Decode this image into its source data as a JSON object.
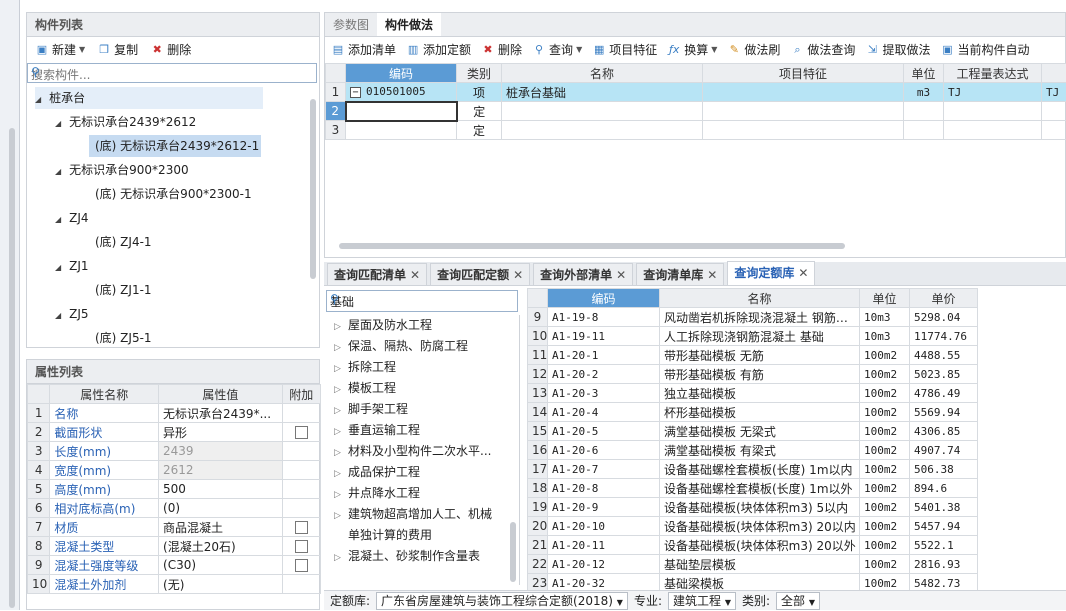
{
  "left_panel": {
    "title": "构件列表",
    "toolbar": {
      "new_label": "新建",
      "copy_label": "复制",
      "delete_label": "删除"
    },
    "search_placeholder": "搜索构件...",
    "tree": [
      {
        "label": "桩承台",
        "level": 0,
        "expanded": true,
        "state": "hl"
      },
      {
        "label": "无标识承台2439*2612",
        "level": 1,
        "expanded": true
      },
      {
        "label": "(底) 无标识承台2439*2612-1",
        "level": 2,
        "state": "sel"
      },
      {
        "label": "无标识承台900*2300",
        "level": 1,
        "expanded": true
      },
      {
        "label": "(底) 无标识承台900*2300-1",
        "level": 2
      },
      {
        "label": "ZJ4",
        "level": 1,
        "expanded": true
      },
      {
        "label": "(底) ZJ4-1",
        "level": 2
      },
      {
        "label": "ZJ1",
        "level": 1,
        "expanded": true
      },
      {
        "label": "(底) ZJ1-1",
        "level": 2
      },
      {
        "label": "ZJ5",
        "level": 1,
        "expanded": true
      },
      {
        "label": "(底) ZJ5-1",
        "level": 2
      }
    ]
  },
  "props_panel": {
    "title": "属性列表",
    "columns": [
      "属性名称",
      "属性值",
      "附加"
    ],
    "rows": [
      {
        "n": "1",
        "name": "名称",
        "value": "无标识承台2439*...",
        "cb": false,
        "gray": false
      },
      {
        "n": "2",
        "name": "截面形状",
        "value": "异形",
        "cb": true,
        "gray": false
      },
      {
        "n": "3",
        "name": "长度(mm)",
        "value": "2439",
        "cb": false,
        "gray": true
      },
      {
        "n": "4",
        "name": "宽度(mm)",
        "value": "2612",
        "cb": false,
        "gray": true
      },
      {
        "n": "5",
        "name": "高度(mm)",
        "value": "500",
        "cb": false,
        "gray": false
      },
      {
        "n": "6",
        "name": "相对底标高(m)",
        "value": "(0)",
        "cb": false,
        "gray": false
      },
      {
        "n": "7",
        "name": "材质",
        "value": "商品混凝土",
        "cb": true,
        "gray": false
      },
      {
        "n": "8",
        "name": "混凝土类型",
        "value": "(混凝土20石)",
        "cb": true,
        "gray": false
      },
      {
        "n": "9",
        "name": "混凝土强度等级",
        "value": "(C30)",
        "cb": true,
        "gray": false
      },
      {
        "n": "10",
        "name": "混凝土外加剂",
        "value": "(无)",
        "cb": false,
        "gray": false
      }
    ]
  },
  "top_tabs": [
    "参数图",
    "构件做法"
  ],
  "method_toolbar": [
    "添加清单",
    "添加定额",
    "删除",
    "查询",
    "项目特征",
    "换算",
    "做法刷",
    "做法查询",
    "提取做法",
    "当前构件自动"
  ],
  "method_table": {
    "columns": [
      "编码",
      "类别",
      "名称",
      "项目特征",
      "单位",
      "工程量表达式",
      ""
    ],
    "rows": [
      {
        "n": "1",
        "code": "010501005",
        "type": "项",
        "name": "桩承台基础",
        "feature": "",
        "unit": "m3",
        "expr": "TJ",
        "extra": "TJ"
      },
      {
        "n": "2",
        "code": "",
        "type": "定",
        "name": "",
        "feature": "",
        "unit": "",
        "expr": "",
        "extra": ""
      },
      {
        "n": "3",
        "code": "",
        "type": "定",
        "name": "",
        "feature": "",
        "unit": "",
        "expr": "",
        "extra": ""
      }
    ]
  },
  "query_tabs": [
    {
      "label": "查询匹配清单",
      "active": false
    },
    {
      "label": "查询匹配定额",
      "active": false
    },
    {
      "label": "查询外部清单",
      "active": false
    },
    {
      "label": "查询清单库",
      "active": false
    },
    {
      "label": "查询定额库",
      "active": true
    }
  ],
  "quota_search": {
    "value": "基础"
  },
  "categories": [
    "屋面及防水工程",
    "保温、隔热、防腐工程",
    "拆除工程",
    "模板工程",
    "脚手架工程",
    "垂直运输工程",
    "材料及小型构件二次水平...",
    "成品保护工程",
    "井点降水工程",
    "建筑物超高增加人工、机械",
    "单独计算的费用",
    "混凝土、砂浆制作含量表"
  ],
  "quota_table": {
    "columns": [
      "编码",
      "名称",
      "单位",
      "单价"
    ],
    "rows": [
      {
        "n": "9",
        "code": "A1-19-8",
        "name": "风动凿岩机拆除现浇混凝土 钢筋…",
        "unit": "10m3",
        "price": "5298.04"
      },
      {
        "n": "10",
        "code": "A1-19-11",
        "name": "人工拆除现浇钢筋混凝土 基础",
        "unit": "10m3",
        "price": "11774.76"
      },
      {
        "n": "11",
        "code": "A1-20-1",
        "name": "带形基础模板 无筋",
        "unit": "100m2",
        "price": "4488.55"
      },
      {
        "n": "12",
        "code": "A1-20-2",
        "name": "带形基础模板 有筋",
        "unit": "100m2",
        "price": "5023.85"
      },
      {
        "n": "13",
        "code": "A1-20-3",
        "name": "独立基础模板",
        "unit": "100m2",
        "price": "4786.49"
      },
      {
        "n": "14",
        "code": "A1-20-4",
        "name": "杯形基础模板",
        "unit": "100m2",
        "price": "5569.94"
      },
      {
        "n": "15",
        "code": "A1-20-5",
        "name": "满堂基础模板 无梁式",
        "unit": "100m2",
        "price": "4306.85"
      },
      {
        "n": "16",
        "code": "A1-20-6",
        "name": "满堂基础模板 有梁式",
        "unit": "100m2",
        "price": "4907.74"
      },
      {
        "n": "17",
        "code": "A1-20-7",
        "name": "设备基础螺栓套模板(长度) 1m以内",
        "unit": "100m2",
        "price": "506.38"
      },
      {
        "n": "18",
        "code": "A1-20-8",
        "name": "设备基础螺栓套模板(长度) 1m以外",
        "unit": "100m2",
        "price": "894.6"
      },
      {
        "n": "19",
        "code": "A1-20-9",
        "name": "设备基础模板(块体体积m3) 5以内",
        "unit": "100m2",
        "price": "5401.38"
      },
      {
        "n": "20",
        "code": "A1-20-10",
        "name": "设备基础模板(块体体积m3) 20以内",
        "unit": "100m2",
        "price": "5457.94"
      },
      {
        "n": "21",
        "code": "A1-20-11",
        "name": "设备基础模板(块体体积m3) 20以外",
        "unit": "100m2",
        "price": "5522.1"
      },
      {
        "n": "22",
        "code": "A1-20-12",
        "name": "基础垫层模板",
        "unit": "100m2",
        "price": "2816.93"
      },
      {
        "n": "23",
        "code": "A1-20-32",
        "name": "基础梁模板",
        "unit": "100m2",
        "price": "5482.73"
      }
    ]
  },
  "status_bar": {
    "lib_label": "定额库:",
    "lib_value": "广东省房屋建筑与装饰工程综合定额(2018)",
    "major_label": "专业:",
    "major_value": "建筑工程",
    "type_label": "类别:",
    "type_value": "全部"
  }
}
